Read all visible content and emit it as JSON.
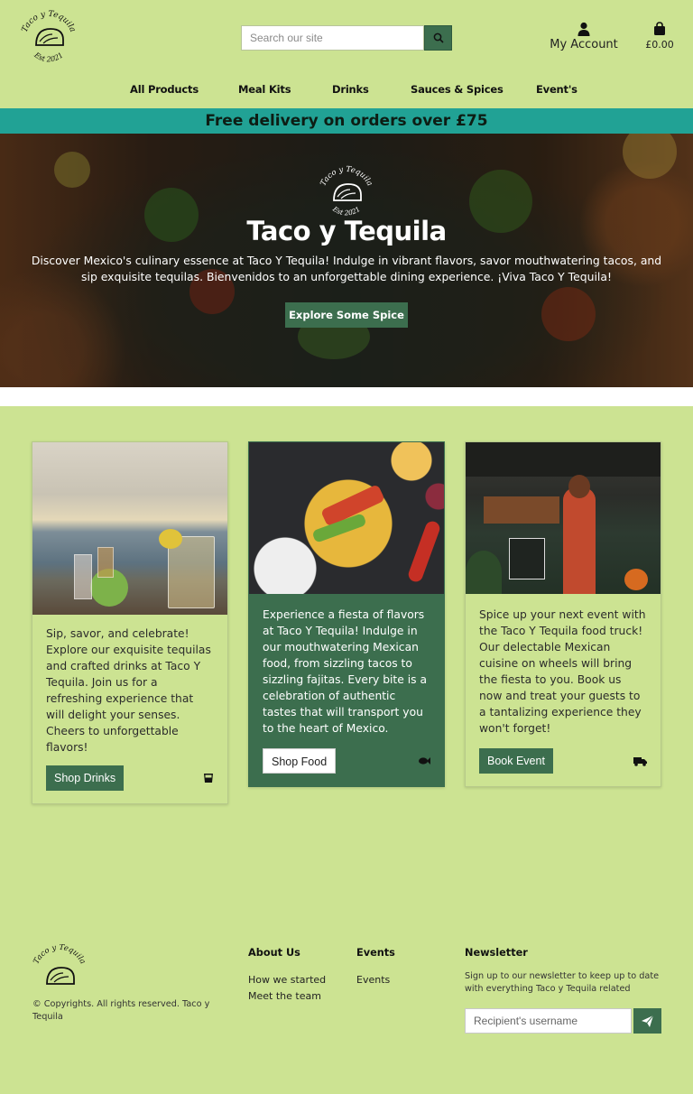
{
  "brand": {
    "logo_text_top": "Taco y Tequila",
    "logo_text_bottom": "Est 2021"
  },
  "search": {
    "placeholder": "Search our site"
  },
  "account": {
    "label": "My Account"
  },
  "cart": {
    "total": "£0.00"
  },
  "nav": {
    "items": [
      "All Products",
      "Meal Kits",
      "Drinks",
      "Sauces & Spices",
      "Event's"
    ]
  },
  "promo": {
    "text": "Free delivery on orders over £75"
  },
  "hero": {
    "title": "Taco y Tequila",
    "text": "Discover Mexico's culinary essence at Taco Y Tequila! Indulge in vibrant flavors, savor mouthwatering tacos, and sip exquisite tequilas. Bienvenidos to an unforgettable dining experience. ¡Viva Taco Y Tequila!",
    "button": "Explore Some Spice"
  },
  "cards": [
    {
      "text": "Sip, savor, and celebrate! Explore our exquisite tequilas and crafted drinks at Taco Y Tequila. Join us for a refreshing experience that will delight your senses. Cheers to unforgettable flavors!",
      "button": "Shop Drinks",
      "icon": "glass-icon"
    },
    {
      "text": "Experience a fiesta of flavors at Taco Y Tequila! Indulge in our mouthwatering Mexican food, from sizzling tacos to sizzling fajitas. Every bite is a celebration of authentic tastes that will transport you to the heart of Mexico.",
      "button": "Shop Food",
      "icon": "fish-icon"
    },
    {
      "text": "Spice up your next event with the Taco Y Tequila food truck! Our delectable Mexican cuisine on wheels will bring the fiesta to you. Book us now and treat your guests to a tantalizing experience they won't forget!",
      "button": "Book Event",
      "icon": "truck-icon"
    }
  ],
  "footer": {
    "copyright": "© Copyrights. All rights reserved. Taco y Tequila",
    "about": {
      "heading": "About Us",
      "links": [
        "How we started",
        "Meet the team"
      ]
    },
    "events": {
      "heading": "Events",
      "links": [
        "Events"
      ]
    },
    "newsletter": {
      "heading": "Newsletter",
      "text": "Sign up to our newsletter to keep up to date with everything Taco y Tequila related",
      "placeholder": "Recipient's username"
    }
  },
  "colors": {
    "background": "#cce392",
    "primary": "#3c6e4e",
    "promo": "#21a295"
  }
}
